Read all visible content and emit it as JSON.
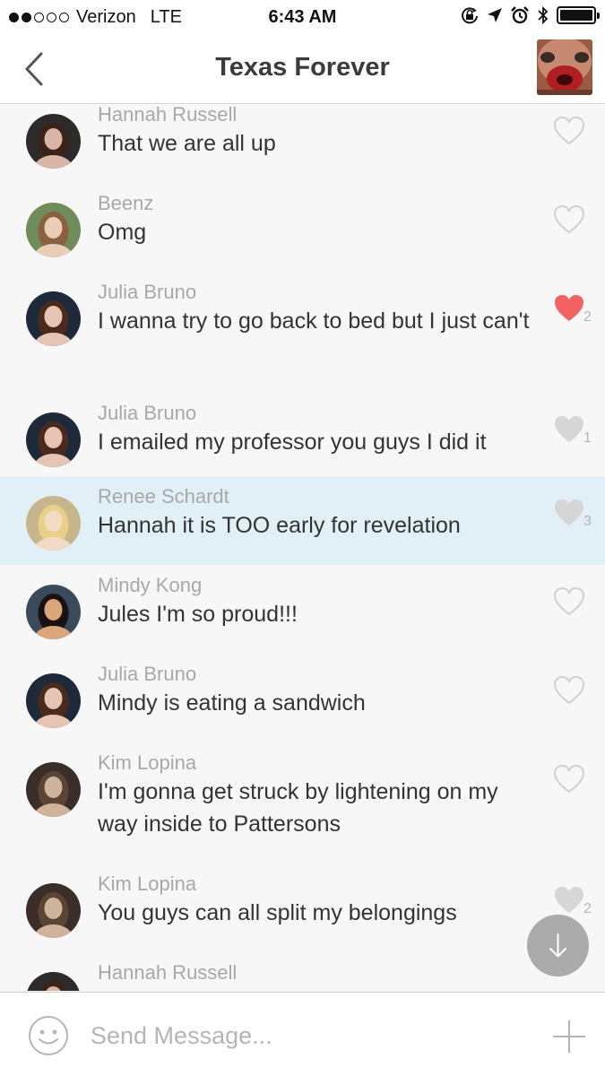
{
  "status_bar": {
    "carrier": "Verizon",
    "network": "LTE",
    "time": "6:43 AM",
    "icons": [
      "signal-dots-icon",
      "rotation-lock-icon",
      "location-arrow-icon",
      "alarm-icon",
      "bluetooth-icon",
      "battery-icon"
    ]
  },
  "header": {
    "title": "Texas Forever",
    "back_icon": "chevron-left-icon"
  },
  "messages": [
    {
      "sender": "Hannah Russell",
      "text": "That we are all up",
      "liked": false,
      "likes": ""
    },
    {
      "sender": "Beenz",
      "text": "Omg",
      "liked": false,
      "likes": ""
    },
    {
      "sender": "Julia Bruno",
      "text": "I wanna try to go back to bed but I just can't",
      "liked": true,
      "likes": "2"
    },
    {
      "sender": "Julia Bruno",
      "text": "I emailed my professor you guys I did it",
      "liked": false,
      "likes": "1"
    },
    {
      "sender": "Renee Schardt",
      "text": "Hannah it is TOO early for revelation",
      "liked": false,
      "likes": "3",
      "highlighted": true
    },
    {
      "sender": "Mindy Kong",
      "text": "Jules I'm so proud!!!",
      "liked": false,
      "likes": ""
    },
    {
      "sender": "Julia Bruno",
      "text": "Mindy is eating a sandwich",
      "liked": false,
      "likes": ""
    },
    {
      "sender": "Kim Lopina",
      "text": "I'm gonna get struck by lightening on my way inside to Pattersons",
      "liked": false,
      "likes": ""
    },
    {
      "sender": "Kim Lopina",
      "text": "You guys can all split my belongings",
      "liked": false,
      "likes": "2"
    },
    {
      "sender": "Hannah Russell",
      "text": "",
      "liked": false,
      "likes": ""
    }
  ],
  "composer": {
    "placeholder": "Send Message...",
    "value": ""
  },
  "colors": {
    "liked_heart": "#f26262",
    "filled_heart": "#d6d6d6",
    "outline_heart": "#d0d0d0",
    "highlight_row": "#e1f0f7",
    "name_text": "#a8a8a8",
    "message_text": "#333333"
  }
}
